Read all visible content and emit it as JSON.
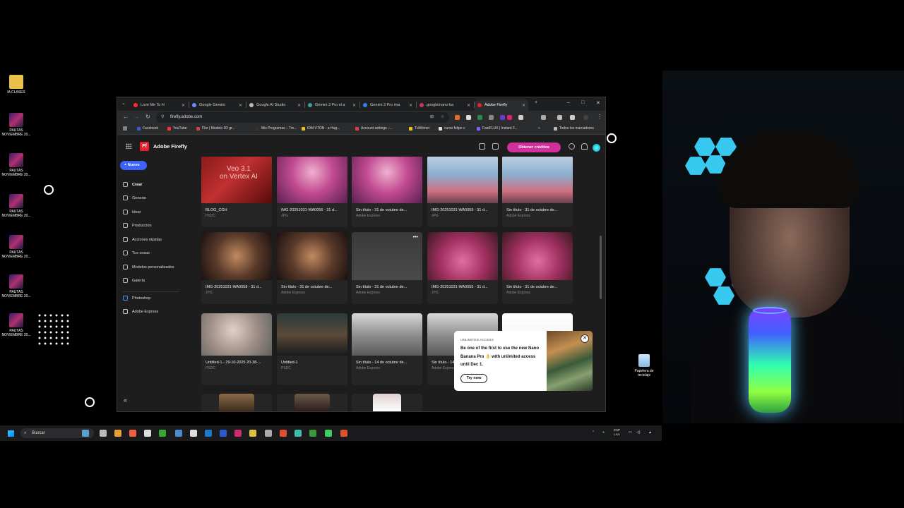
{
  "desktop": {
    "icons": [
      {
        "label": "IA CLASES",
        "kind": "folder"
      },
      {
        "label": "PAUTAS NOVIEMBRE 20...",
        "kind": "poster"
      },
      {
        "label": "PAUTAS NOVIEMBRE 20...",
        "kind": "poster"
      },
      {
        "label": "PAUTAS NOVIEMBRE 20...",
        "kind": "poster"
      },
      {
        "label": "PAUTAS NOVIEMBRE 20...",
        "kind": "poster"
      },
      {
        "label": "PAUTAS NOVIEMBRE 20...",
        "kind": "poster"
      },
      {
        "label": "PAUTAS NOVIEMBRE 20...",
        "kind": "poster"
      }
    ],
    "recycle_bin": "Papelera de reciclaje"
  },
  "browser": {
    "tabs": [
      {
        "title": "Love Me To H",
        "icon": "youtube-icon",
        "color": "#ff2d2d"
      },
      {
        "title": "Google Gemini",
        "icon": "gemini-icon",
        "color": "#6a8cff"
      },
      {
        "title": "Google AI Studio",
        "icon": "ai-studio-icon",
        "color": "#bbbbbb"
      },
      {
        "title": "Gemini 3 Pro el a",
        "icon": "page-icon",
        "color": "#3aa0a0"
      },
      {
        "title": "Gemini 3 Pro ima",
        "icon": "chrome-icon",
        "color": "#3a7cf0"
      },
      {
        "title": "google/nano-ba",
        "icon": "github-icon",
        "color": "#d03060"
      },
      {
        "title": "Adobe Firefly",
        "icon": "firefly-icon",
        "color": "#e8212e",
        "active": true
      }
    ],
    "url": "firefly.adobe.com",
    "bookmarks": [
      {
        "label": "Facebook",
        "color": "#3b5bdb"
      },
      {
        "label": "YouTube",
        "color": "#ff2d2d"
      },
      {
        "label": "Flor | Modelo 3D gr...",
        "color": "#d04040"
      },
      {
        "label": "Mis Programas – Tre...",
        "color": "#333333"
      },
      {
        "label": "IDM VTON - a Hug...",
        "color": "#f0c020"
      },
      {
        "label": "Account settings –...",
        "color": "#e04040"
      },
      {
        "label": "TuWinner",
        "color": "#f0c020"
      },
      {
        "label": "curso felipe v",
        "color": "#dddddd"
      },
      {
        "label": "FastFLUX | Instant F...",
        "color": "#8060ff"
      }
    ],
    "all_bookmarks": "Todos los marcadores"
  },
  "app": {
    "logo": "Ff",
    "title": "Adobe Firefly",
    "credits_button": "Obtener créditos",
    "new_button": "Nuevo",
    "nav": [
      {
        "label": "Crear",
        "active": true
      },
      {
        "label": "Generar"
      },
      {
        "label": "Idear"
      },
      {
        "label": "Producción"
      },
      {
        "label": "Acciones rápidas"
      },
      {
        "label": "Tus cosas"
      },
      {
        "label": "Modelos personalizados"
      },
      {
        "label": "Galería"
      }
    ],
    "apps": [
      {
        "label": "Photoshop"
      },
      {
        "label": "Adobe Express"
      }
    ],
    "collapse": "«"
  },
  "gallery": [
    {
      "title": "BLOG_CGH",
      "type": "PSDC",
      "thumb": "linear-gradient(135deg,#8a1a1a,#c03030 45%,#5a0a0a)",
      "overlay": "Veo 3.1\non Vertex AI"
    },
    {
      "title": "IMG-20251031-WA0056 - 31 d...",
      "type": "JPG",
      "thumb": "radial-gradient(circle at 50% 35%,#f0b0d0,#c04a90 45%,#5a2050)"
    },
    {
      "title": "Sin título - 31 de octubre de...",
      "type": "Adobe Express",
      "thumb": "radial-gradient(circle at 50% 35%,#f0b0d0,#c04a90 45%,#5a2050)"
    },
    {
      "title": "IMG-20251031-WA0059 - 31 d...",
      "type": "JPG",
      "thumb": "linear-gradient(180deg,#c0d0e0,#8ab0d0 40%,#d07080 75%,#6a4050)"
    },
    {
      "title": "Sin título - 31 de octubre de...",
      "type": "Adobe Express",
      "thumb": "linear-gradient(180deg,#c0d0e0,#8ab0d0 40%,#d07080 75%,#6a4050)"
    },
    {
      "title": "IMG-20251031-WA0058 - 31 d...",
      "type": "JPG",
      "thumb": "radial-gradient(circle at 50% 50%,#c08a60,#5a3a2a 50%,#1a1010)"
    },
    {
      "title": "Sin título - 31 de octubre de...",
      "type": "Adobe Express",
      "thumb": "radial-gradient(circle at 50% 50%,#c08a60,#5a3a2a 50%,#1a1010)"
    },
    {
      "title": "Sin título - 31 de octubre de...",
      "type": "Adobe Express",
      "thumb": "linear-gradient(180deg,#3a3a3a,#4a4a4a)",
      "more": true
    },
    {
      "title": "IMG-20251031-WA0055 - 31 d...",
      "type": "JPG",
      "thumb": "radial-gradient(circle at 50% 60%,#e070a0,#a03060 50%,#3a1a20)"
    },
    {
      "title": "Sin título - 31 de octubre de...",
      "type": "Adobe Express",
      "thumb": "radial-gradient(circle at 50% 60%,#e070a0,#a03060 50%,#3a1a20)"
    },
    {
      "title": "Untitled-1 - 29-10-2025 20-38-...",
      "type": "PSDC",
      "thumb": "radial-gradient(circle at 45% 40%,#e0d0c8,#a09088 50%,#606060)"
    },
    {
      "title": "Untitled-1",
      "type": "PSDC",
      "thumb": "linear-gradient(180deg,#2a3a3a,#5a4a3a 50%,#1a1a1a)"
    },
    {
      "title": "Sin título - 14 de octubre de...",
      "type": "Adobe Express",
      "thumb": "linear-gradient(180deg,#d8d8d8,#8a8a8a 55%,#5a5a5a)"
    },
    {
      "title": "Sin título - 14...",
      "type": "Adobe Express",
      "thumb": "linear-gradient(180deg,#d8d8d8,#8a8a8a 55%,#5a5a5a)"
    },
    {
      "title": "",
      "type": "",
      "thumb": "linear-gradient(180deg,#ffffff,#f0f0f0)"
    },
    {
      "title": "",
      "type": "",
      "thumb": "linear-gradient(180deg,#8a6a4a,#3a2a1a)"
    },
    {
      "title": "",
      "type": "",
      "thumb": "linear-gradient(180deg,#6a5a4a,#2a1a1a)"
    },
    {
      "title": "",
      "type": "",
      "thumb": "linear-gradient(180deg,#e0d0d0,#ffffff)"
    }
  ],
  "promo": {
    "kicker": "UNLIMITED ACCESS",
    "text": "Be one of the first to use the new Nano Banana Pro 👌 with unlimited access until Dec 1.",
    "button": "Try now"
  },
  "taskbar": {
    "search_placeholder": "Buscar",
    "lang_top": "ESP",
    "lang_bottom": "LAA"
  }
}
